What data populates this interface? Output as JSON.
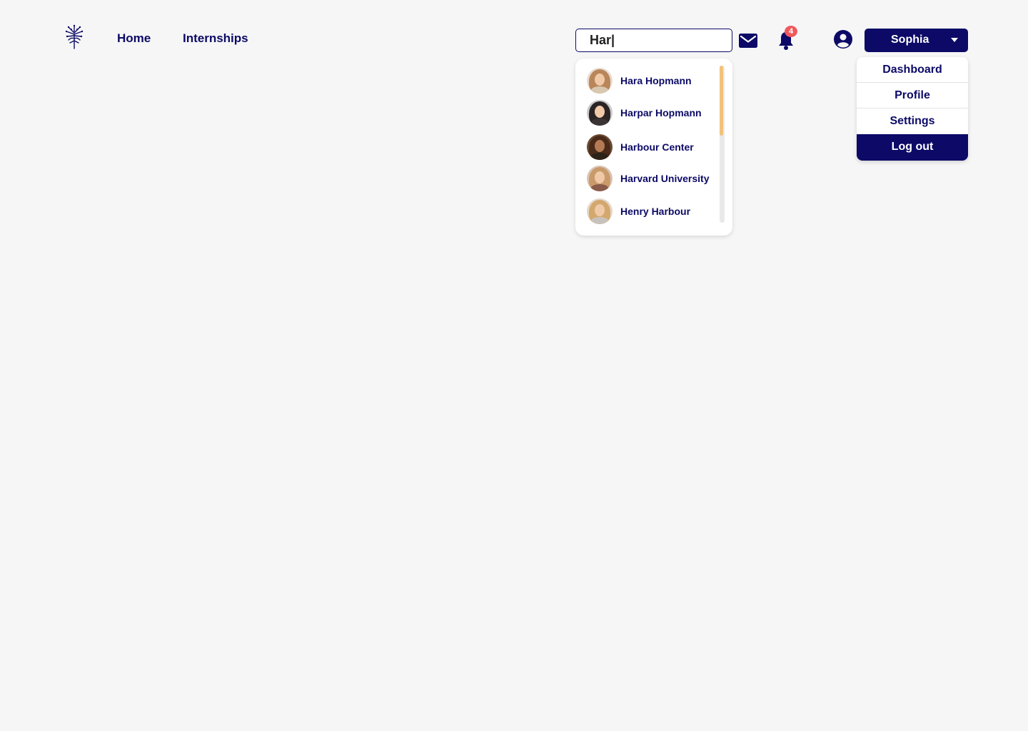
{
  "nav": {
    "logo": "tree-logo",
    "links": [
      {
        "label": "Home"
      },
      {
        "label": "Internships"
      }
    ]
  },
  "search": {
    "value": "Har|",
    "results": [
      {
        "name": "Hara Hopmann",
        "hair": "#b8865a",
        "clothes": "#d9c8b0"
      },
      {
        "name": "Harpar Hopmann",
        "hair": "#2a2424",
        "clothes": "#3b3434"
      },
      {
        "name": "Harbour Center",
        "hair": "#4a2a18",
        "clothes": "#2d2218"
      },
      {
        "name": "Harvard University",
        "hair": "#c99a6a",
        "clothes": "#8a5a4a"
      },
      {
        "name": "Henry Harbour",
        "hair": "#d2a86e",
        "clothes": "#c8c2bc"
      }
    ]
  },
  "header": {
    "notifications_count": "4",
    "user_name": "Sophia"
  },
  "user_menu": {
    "items": [
      "Dashboard",
      "Profile",
      "Settings",
      "Log out"
    ]
  },
  "colors": {
    "primary": "#0c0a66",
    "background": "#f6f6f6",
    "badge": "#f0595c",
    "scroll_thumb": "#f2c27c"
  }
}
